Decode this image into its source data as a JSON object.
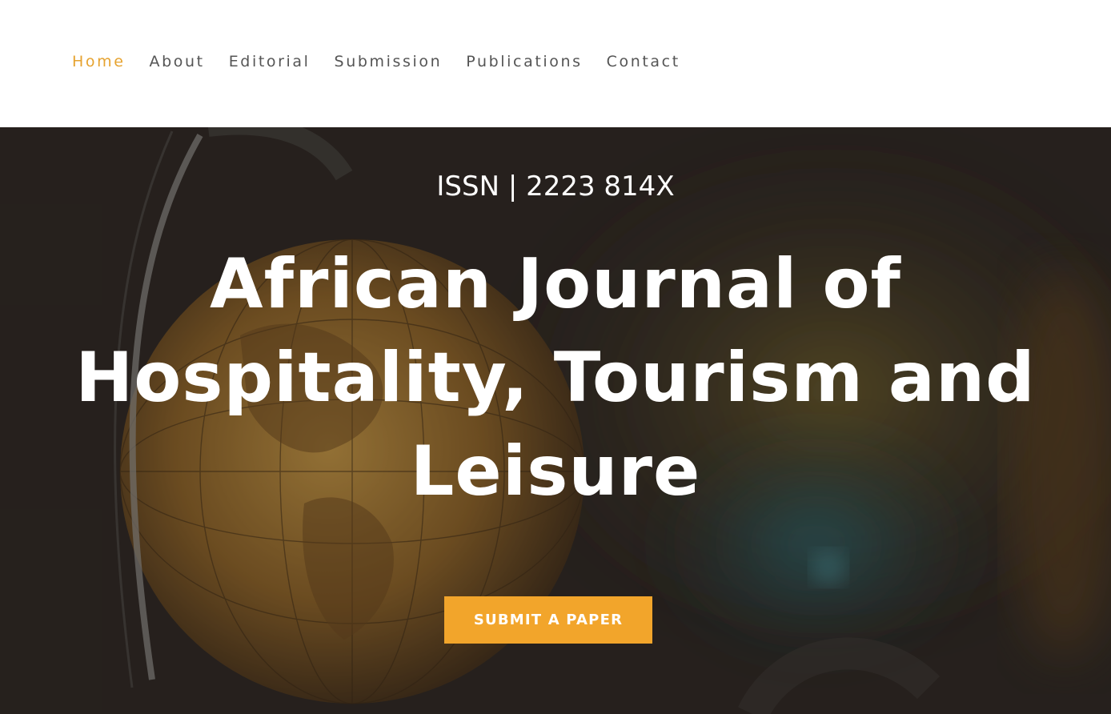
{
  "nav": {
    "items": [
      {
        "label": "Home",
        "active": true
      },
      {
        "label": "About",
        "active": false
      },
      {
        "label": "Editorial",
        "active": false
      },
      {
        "label": "Submission",
        "active": false
      },
      {
        "label": "Publications",
        "active": false
      },
      {
        "label": "Contact",
        "active": false
      }
    ]
  },
  "hero": {
    "issn": "ISSN | 2223 814X",
    "title": "African Journal of Hospitality, Tourism and Leisure",
    "cta_label": "SUBMIT A PAPER"
  },
  "colors": {
    "accent": "#e6a330",
    "button": "#f2a52b",
    "nav_text": "#555555",
    "hero_text": "#ffffff"
  }
}
